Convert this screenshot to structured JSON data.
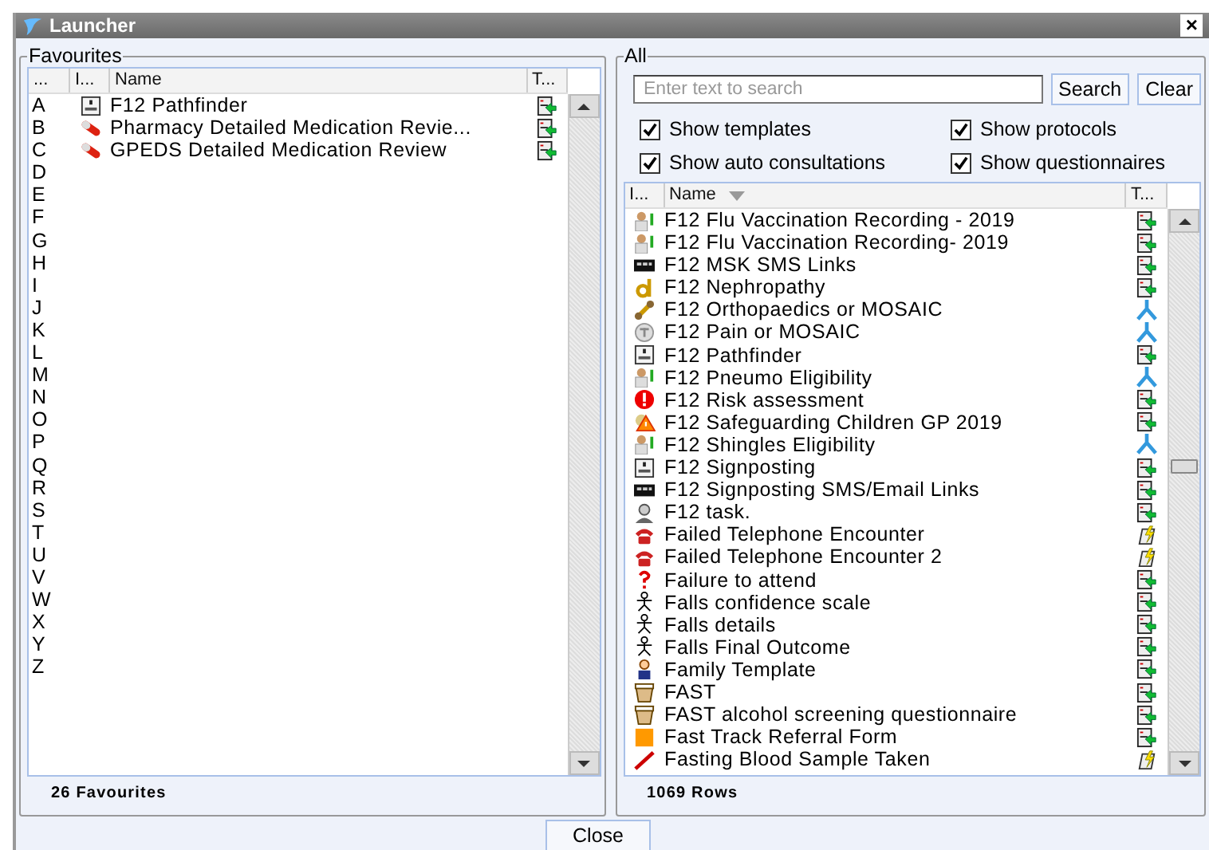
{
  "window": {
    "title": "Launcher",
    "close": "×"
  },
  "favourites": {
    "title": "Favourites",
    "columns": [
      "...",
      "I...",
      "Name",
      "T..."
    ],
    "letters": [
      "A",
      "B",
      "C",
      "D",
      "E",
      "F",
      "G",
      "H",
      "I",
      "J",
      "K",
      "L",
      "M",
      "N",
      "O",
      "P",
      "Q",
      "R",
      "S",
      "T",
      "U",
      "V",
      "W",
      "X",
      "Y",
      "Z"
    ],
    "rows": [
      {
        "name": "F12 Pathfinder",
        "kind": "template"
      },
      {
        "name": "Pharmacy Detailed Medication Revie...",
        "kind": "template"
      },
      {
        "name": "GPEDS Detailed Medication Review",
        "kind": "template"
      }
    ],
    "footer": "26 Favourites"
  },
  "all": {
    "title": "All",
    "search": {
      "placeholder": "Enter text to search"
    },
    "search_button": "Search",
    "clear_button": "Clear",
    "options": [
      {
        "label": "Show templates",
        "checked": true
      },
      {
        "label": "Show protocols",
        "checked": true
      },
      {
        "label": "Show auto consultations",
        "checked": true
      },
      {
        "label": "Show questionnaires",
        "checked": true
      }
    ],
    "columns": [
      "I...",
      "Name",
      "T..."
    ],
    "rows": [
      {
        "name": "F12 Flu Vaccination Recording - 2019",
        "kind": "template"
      },
      {
        "name": "F12 Flu Vaccination Recording- 2019",
        "kind": "template"
      },
      {
        "name": "F12 MSK SMS Links",
        "kind": "template"
      },
      {
        "name": "F12 Nephropathy",
        "kind": "template"
      },
      {
        "name": "F12 Orthopaedics or MOSAIC",
        "kind": "protocol"
      },
      {
        "name": "F12 Pain or MOSAIC",
        "kind": "protocol"
      },
      {
        "name": "F12 Pathfinder",
        "kind": "template"
      },
      {
        "name": "F12 Pneumo Eligibility",
        "kind": "protocol"
      },
      {
        "name": "F12 Risk assessment",
        "kind": "template"
      },
      {
        "name": "F12 Safeguarding Children GP 2019",
        "kind": "template"
      },
      {
        "name": "F12 Shingles Eligibility",
        "kind": "protocol"
      },
      {
        "name": "F12 Signposting",
        "kind": "template"
      },
      {
        "name": "F12 Signposting SMS/Email Links",
        "kind": "template"
      },
      {
        "name": "F12 task.",
        "kind": "template"
      },
      {
        "name": "Failed Telephone Encounter",
        "kind": "auto"
      },
      {
        "name": "Failed Telephone Encounter 2",
        "kind": "auto"
      },
      {
        "name": "Failure to attend",
        "kind": "template"
      },
      {
        "name": "Falls confidence scale",
        "kind": "template"
      },
      {
        "name": "Falls details",
        "kind": "template"
      },
      {
        "name": "Falls Final Outcome",
        "kind": "template"
      },
      {
        "name": "Family Template",
        "kind": "template"
      },
      {
        "name": "FAST",
        "kind": "template"
      },
      {
        "name": "FAST alcohol screening questionnaire",
        "kind": "template"
      },
      {
        "name": "Fast Track Referral Form",
        "kind": "template"
      },
      {
        "name": "Fasting Blood Sample Taken",
        "kind": "auto"
      }
    ],
    "footer": "1069 Rows"
  },
  "close_button": "Close"
}
